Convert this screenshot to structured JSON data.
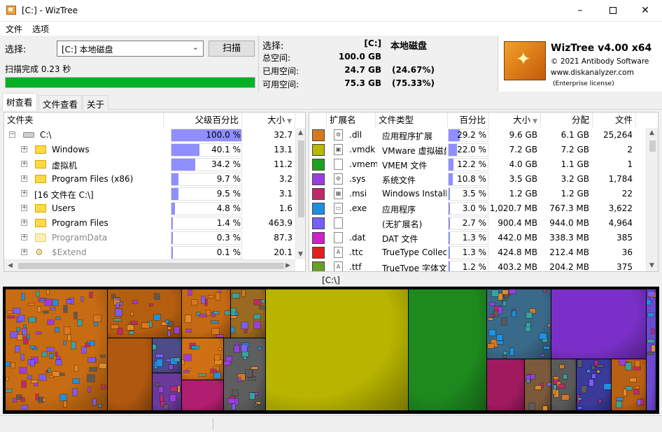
{
  "window": {
    "title": "[C:]  - WizTree",
    "minimize_label": "–",
    "close_label": "✕"
  },
  "menu": {
    "items": [
      "文件",
      "选项"
    ]
  },
  "scan": {
    "select_label": "选择:",
    "drive_value": "[C:] 本地磁盘",
    "scan_button": "扫描",
    "status_text": "扫描完成 0.23 秒",
    "progress_fraction": 1.0
  },
  "stats": {
    "selection_label": "选择:",
    "selection_drive": "[C:]",
    "selection_name": "本地磁盘",
    "total_label": "总空间:",
    "total_value": "100.0 GB",
    "used_label": "已用空间:",
    "used_value": "24.7 GB",
    "used_pct": "(24.67%)",
    "free_label": "可用空间:",
    "free_value": "75.3 GB",
    "free_pct": "(75.33%)"
  },
  "brand": {
    "name": "WizTree v4.00 x64",
    "copyright": "© 2021 Antibody Software",
    "site": "www.diskanalyzer.com",
    "license": "(Enterprise license)"
  },
  "tabs": [
    "树查看",
    "文件查看",
    "关于"
  ],
  "tree": {
    "headers": {
      "folder": "文件夹",
      "parent_pct": "父级百分比",
      "size": "大小"
    },
    "rows": [
      {
        "name": "C:\\",
        "pct": "100.0 %",
        "pct_fraction": 1.0,
        "size": "32.7",
        "icon": "drive",
        "expander": "−",
        "level": 0
      },
      {
        "name": "Windows",
        "pct": "40.1 %",
        "pct_fraction": 0.401,
        "size": "13.1",
        "icon": "folder",
        "expander": "+",
        "level": 1
      },
      {
        "name": "虚拟机",
        "pct": "34.2 %",
        "pct_fraction": 0.342,
        "size": "11.2",
        "icon": "folder",
        "expander": "+",
        "level": 1
      },
      {
        "name": "Program Files (x86)",
        "pct": "9.7 %",
        "pct_fraction": 0.097,
        "size": "3.2",
        "icon": "folder",
        "expander": "+",
        "level": 1
      },
      {
        "name": "[16 文件在 C:\\]",
        "pct": "9.5 %",
        "pct_fraction": 0.095,
        "size": "3.1",
        "icon": "none",
        "expander": "+",
        "level": 1
      },
      {
        "name": "Users",
        "pct": "4.8 %",
        "pct_fraction": 0.048,
        "size": "1.6",
        "icon": "folder",
        "expander": "+",
        "level": 1
      },
      {
        "name": "Program Files",
        "pct": "1.4 %",
        "pct_fraction": 0.014,
        "size": "463.9",
        "icon": "folder",
        "expander": "+",
        "level": 1
      },
      {
        "name": "ProgramData",
        "pct": "0.3 %",
        "pct_fraction": 0.003,
        "size": "87.3",
        "icon": "folder-dim",
        "expander": "+",
        "level": 1
      },
      {
        "name": "$Extend",
        "pct": "0.1 %",
        "pct_fraction": 0.001,
        "size": "20.1",
        "icon": "gear",
        "expander": "+",
        "level": 1
      }
    ]
  },
  "ext": {
    "headers": {
      "ext": "扩展名",
      "type": "文件类型",
      "pct": "百分比",
      "size": "大小",
      "alloc": "分配",
      "files": "文件"
    },
    "rows": [
      {
        "color": "#d8781e",
        "ext": ".dll",
        "type": "应用程序扩展",
        "pct": "29.2 %",
        "pct_fraction": 0.292,
        "size": "9.6 GB",
        "alloc": "6.1 GB",
        "files": "25,264",
        "icon": "⚙"
      },
      {
        "color": "#b8b800",
        "ext": ".vmdk",
        "type": "VMware 虚拟磁盘",
        "pct": "22.0 %",
        "pct_fraction": 0.22,
        "size": "7.2 GB",
        "alloc": "7.2 GB",
        "files": "2",
        "icon": "▣"
      },
      {
        "color": "#20a020",
        "ext": ".vmem",
        "type": "VMEM 文件",
        "pct": "12.2 %",
        "pct_fraction": 0.122,
        "size": "4.0 GB",
        "alloc": "1.1 GB",
        "files": "1",
        "icon": ""
      },
      {
        "color": "#9a3de0",
        "ext": ".sys",
        "type": "系统文件",
        "pct": "10.8 %",
        "pct_fraction": 0.108,
        "size": "3.5 GB",
        "alloc": "3.2 GB",
        "files": "1,784",
        "icon": "⚙"
      },
      {
        "color": "#c0286a",
        "ext": ".msi",
        "type": "Windows Installer",
        "pct": "3.5 %",
        "pct_fraction": 0.035,
        "size": "1.2 GB",
        "alloc": "1.2 GB",
        "files": "22",
        "icon": "▦"
      },
      {
        "color": "#1e90e0",
        "ext": ".exe",
        "type": "应用程序",
        "pct": "3.0 %",
        "pct_fraction": 0.03,
        "size": "1,020.7 MB",
        "alloc": "767.3 MB",
        "files": "3,622",
        "icon": "▭"
      },
      {
        "color": "#7a5cff",
        "ext": "",
        "type": "(无扩展名)",
        "pct": "2.7 %",
        "pct_fraction": 0.027,
        "size": "900.4 MB",
        "alloc": "944.0 MB",
        "files": "4,964",
        "icon": ""
      },
      {
        "color": "#d020c8",
        "ext": ".dat",
        "type": "DAT 文件",
        "pct": "1.3 %",
        "pct_fraction": 0.013,
        "size": "442.0 MB",
        "alloc": "338.3 MB",
        "files": "385",
        "icon": ""
      },
      {
        "color": "#e02020",
        "ext": ".ttc",
        "type": "TrueType Collection",
        "pct": "1.3 %",
        "pct_fraction": 0.013,
        "size": "424.8 MB",
        "alloc": "212.4 MB",
        "files": "36",
        "icon": "A"
      },
      {
        "color": "#68a028",
        "ext": ".ttf",
        "type": "TrueType 字体文件",
        "pct": "1.2 %",
        "pct_fraction": 0.012,
        "size": "403.2 MB",
        "alloc": "204.2 MB",
        "files": "375",
        "icon": "A"
      }
    ]
  },
  "treemap": {
    "label": "[C:\\]"
  }
}
